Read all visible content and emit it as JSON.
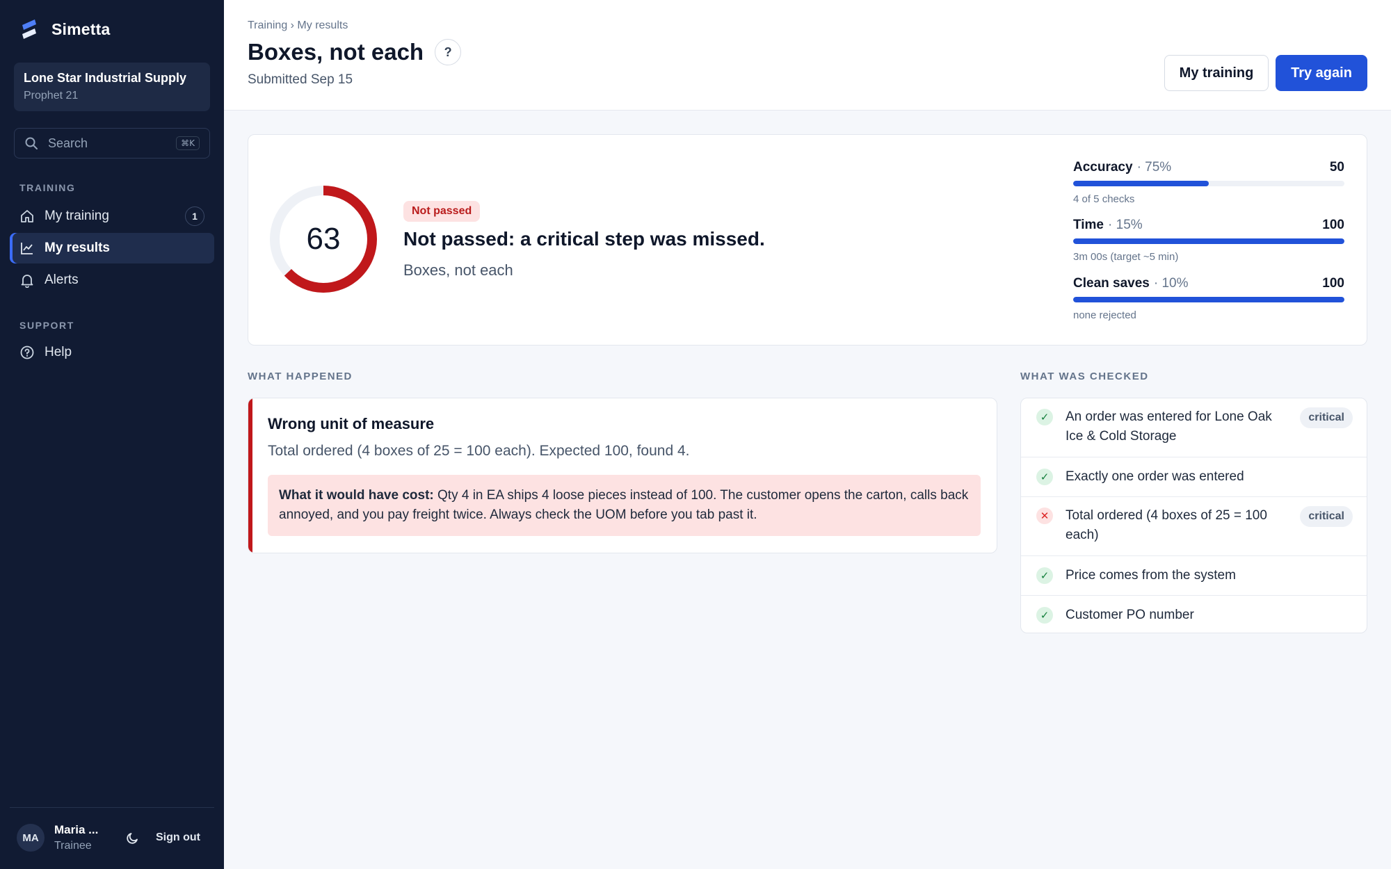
{
  "sidebar": {
    "brand": "Simetta",
    "org": {
      "name": "Lone Star Industrial Supply",
      "system": "Prophet 21"
    },
    "search": {
      "placeholder": "Search",
      "shortcut": "⌘K"
    },
    "sections": [
      {
        "title": "TRAINING",
        "items": [
          {
            "label": "My training",
            "icon": "home-icon",
            "badge": "1",
            "active": false
          },
          {
            "label": "My results",
            "icon": "chart-line-icon",
            "active": true
          },
          {
            "label": "Alerts",
            "icon": "bell-icon",
            "active": false
          }
        ]
      },
      {
        "title": "SUPPORT",
        "items": [
          {
            "label": "Help",
            "icon": "help-circle-icon",
            "active": false
          }
        ]
      }
    ],
    "user": {
      "initials": "MA",
      "name": "Maria ...",
      "role": "Trainee",
      "sign_out": "Sign out"
    }
  },
  "header": {
    "breadcrumb": "Training › My results",
    "title": "Boxes, not each",
    "help": "?",
    "submitted": "Submitted Sep 15",
    "secondary_button": "My training",
    "primary_button": "Try again"
  },
  "score": {
    "value": "63",
    "ring_fraction": 0.63,
    "status": "Not passed",
    "headline": "Not passed: a critical step was missed.",
    "scenario": "Boxes, not each",
    "metrics": [
      {
        "name": "Accuracy",
        "weight": "· 75%",
        "score": "50",
        "fill": 0.5,
        "note": "4 of 5 checks"
      },
      {
        "name": "Time",
        "weight": "· 15%",
        "score": "100",
        "fill": 1.0,
        "note": "3m 00s (target ~5 min)"
      },
      {
        "name": "Clean saves",
        "weight": "· 10%",
        "score": "100",
        "fill": 1.0,
        "note": "none rejected"
      }
    ]
  },
  "what_happened": {
    "label": "WHAT HAPPENED",
    "title": "Wrong unit of measure",
    "description": "Total ordered (4 boxes of 25 = 100 each). Expected 100, found 4.",
    "cost_label": "What it would have cost:",
    "cost_text": " Qty 4 in EA ships 4 loose pieces instead of 100. The customer opens the carton, calls back annoyed, and you pay freight twice. Always check the UOM before you tab past it."
  },
  "what_was_checked": {
    "label": "WHAT WAS CHECKED",
    "items": [
      {
        "text": "An order was entered for Lone Oak Ice & Cold Storage",
        "passed": true,
        "tag": "critical"
      },
      {
        "text": "Exactly one order was entered",
        "passed": true,
        "tag": ""
      },
      {
        "text": "Total ordered (4 boxes of 25 = 100 each)",
        "passed": false,
        "tag": "critical"
      },
      {
        "text": "Price comes from the system",
        "passed": true,
        "tag": ""
      },
      {
        "text": "Customer PO number",
        "passed": true,
        "tag": ""
      }
    ]
  },
  "colors": {
    "accent": "#2152d9",
    "danger": "#c0181b",
    "sidebar": "#111b33"
  }
}
